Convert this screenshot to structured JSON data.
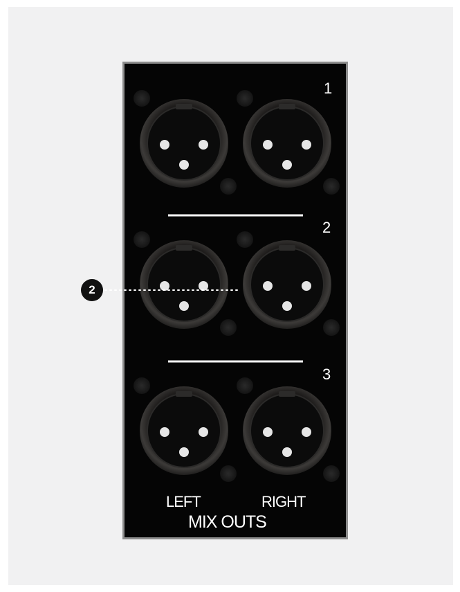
{
  "panel": {
    "groups": [
      {
        "number": "1"
      },
      {
        "number": "2"
      },
      {
        "number": "3"
      }
    ],
    "channel_labels": {
      "left": "LEFT",
      "right": "RIGHT"
    },
    "title": "MIX OUTS"
  },
  "callout": {
    "label": "2"
  },
  "colors": {
    "panel": "#050505",
    "border": "#8d8d8d",
    "text": "#ffffff",
    "connector": "#3a3836"
  }
}
